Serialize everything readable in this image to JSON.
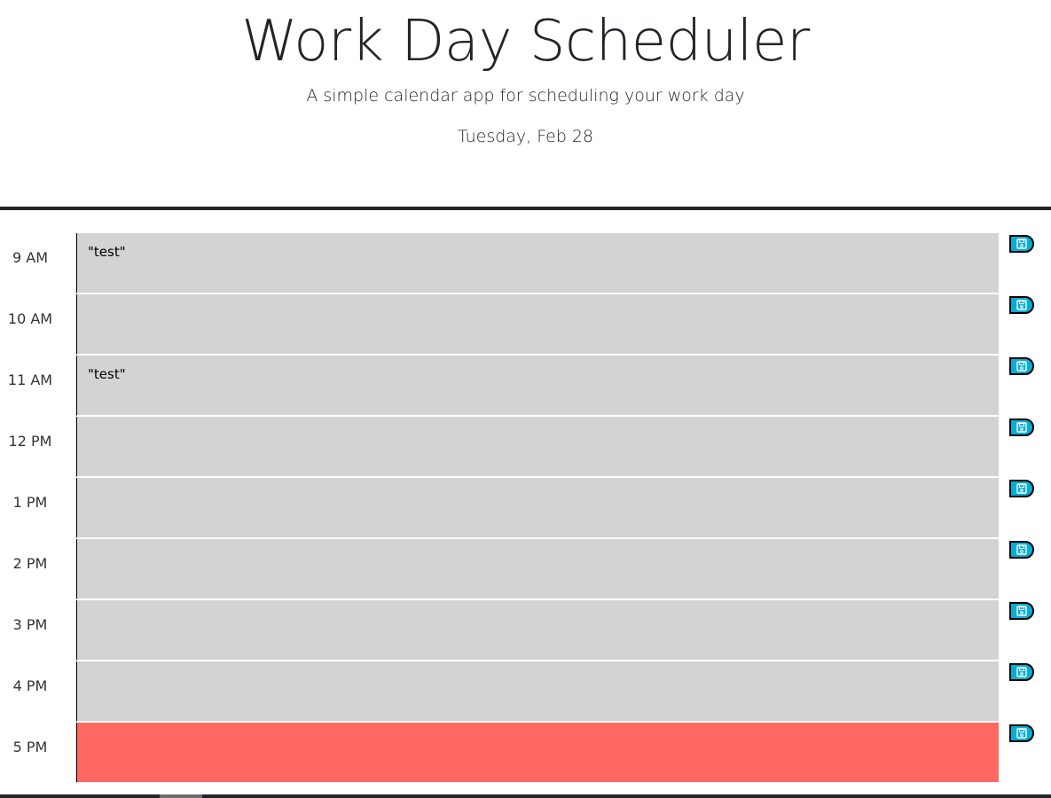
{
  "header": {
    "title": "Work Day Scheduler",
    "subtitle": "A simple calendar app for scheduling your work day",
    "current_day": "Tuesday, Feb 28"
  },
  "colors": {
    "past": "#d3d3d3",
    "present": "#ff6961",
    "save_button": "#06aed5"
  },
  "save_icon": "floppy-disk-icon",
  "time_blocks": [
    {
      "hour": "9 AM",
      "text": "\"test\"",
      "state": "past"
    },
    {
      "hour": "10 AM",
      "text": "",
      "state": "past"
    },
    {
      "hour": "11 AM",
      "text": "\"test\"",
      "state": "past"
    },
    {
      "hour": "12 PM",
      "text": "",
      "state": "past"
    },
    {
      "hour": "1 PM",
      "text": "",
      "state": "past"
    },
    {
      "hour": "2 PM",
      "text": "",
      "state": "past"
    },
    {
      "hour": "3 PM",
      "text": "",
      "state": "past"
    },
    {
      "hour": "4 PM",
      "text": "",
      "state": "past"
    },
    {
      "hour": "5 PM",
      "text": "",
      "state": "present"
    }
  ]
}
